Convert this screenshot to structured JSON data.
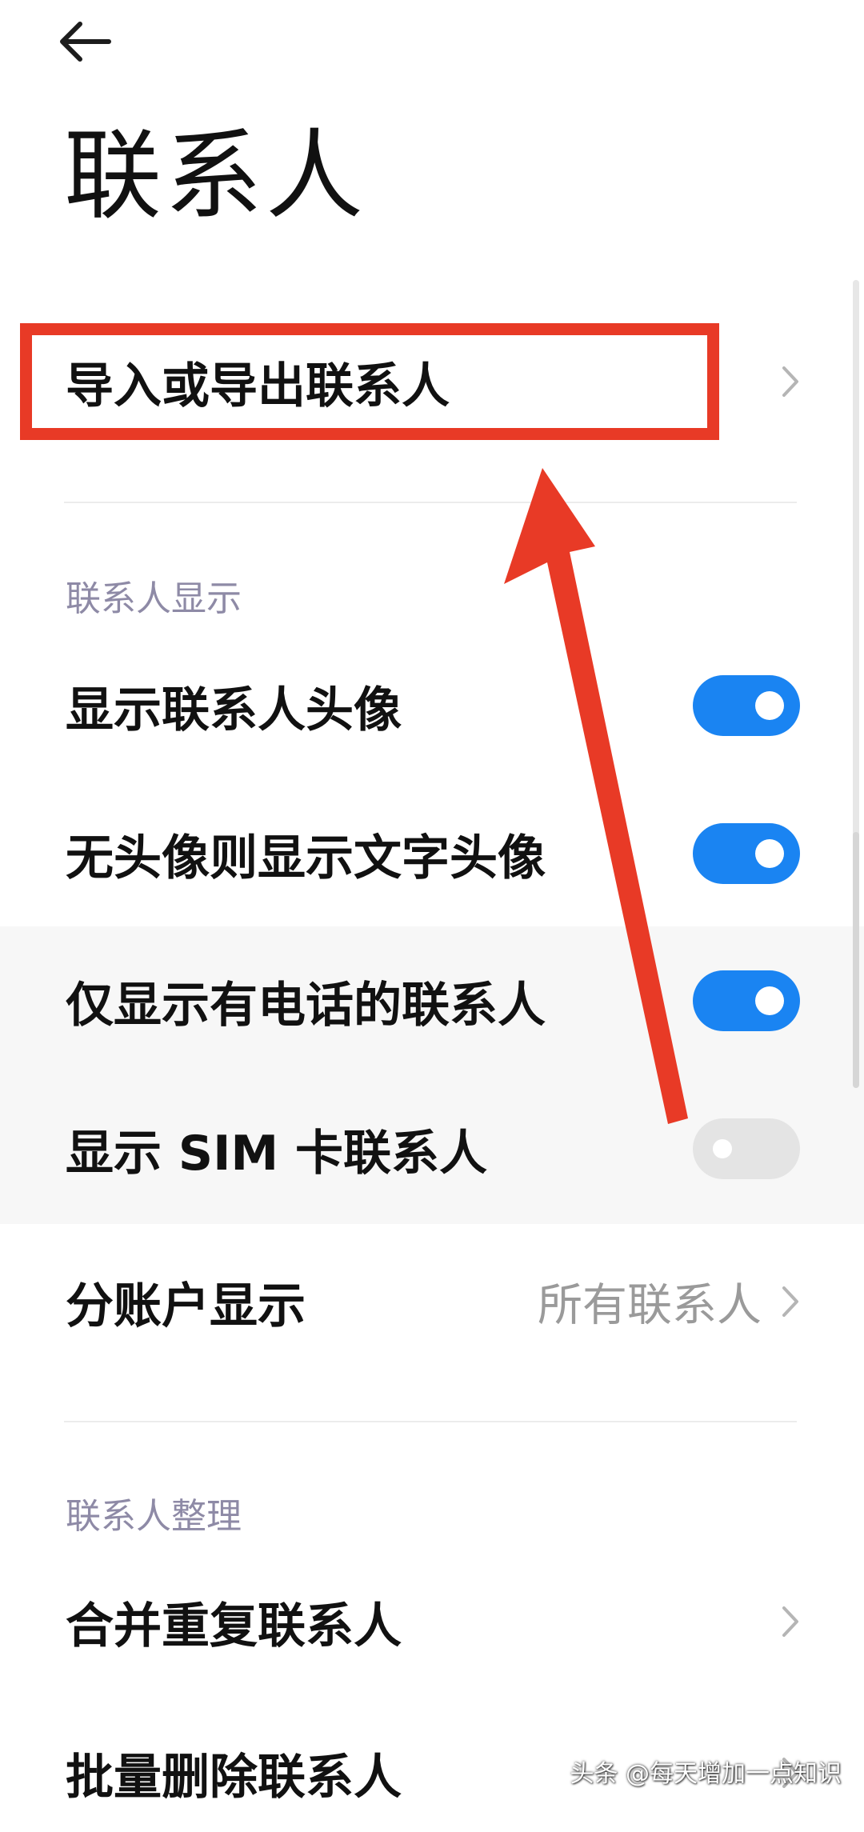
{
  "header": {
    "back_icon": "arrow-left-icon",
    "title": "联系人"
  },
  "import_export": {
    "label": "导入或导出联系人",
    "icon": "chevron-right-icon"
  },
  "display_section": {
    "header": "联系人显示",
    "settings": [
      {
        "label": "显示联系人头像",
        "enabled": true
      },
      {
        "label": "无头像则显示文字头像",
        "enabled": true
      },
      {
        "label": "仅显示有电话的联系人",
        "enabled": true
      },
      {
        "label": "显示 SIM 卡联系人",
        "enabled": false
      }
    ],
    "account_display": {
      "label": "分账户显示",
      "value": "所有联系人"
    }
  },
  "organize_section": {
    "header": "联系人整理",
    "items": [
      {
        "label": "合并重复联系人"
      },
      {
        "label": "批量删除联系人"
      }
    ]
  },
  "watermark": "头条 @每天增加一点知识",
  "colors": {
    "toggle_on": "#1a84f2",
    "toggle_off": "#e4e4e4",
    "annotation_red": "#e83a26",
    "section_header": "#8e8aa6"
  }
}
